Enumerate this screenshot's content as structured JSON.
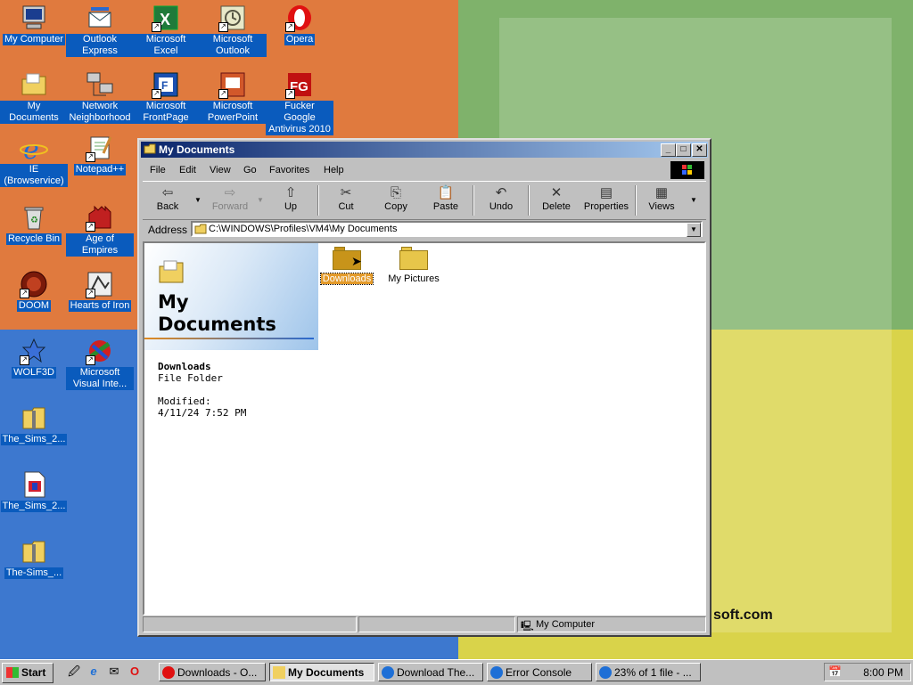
{
  "desktop": {
    "brand_text": "soft.com",
    "icons": [
      {
        "label": "My Computer",
        "icon": "computer-icon"
      },
      {
        "label": "Outlook Express",
        "icon": "outlook-express-icon"
      },
      {
        "label": "Microsoft Excel",
        "icon": "excel-icon"
      },
      {
        "label": "Microsoft Outlook",
        "icon": "outlook-icon"
      },
      {
        "label": "Opera",
        "icon": "opera-icon"
      },
      {
        "label": "My Documents",
        "icon": "folder-icon"
      },
      {
        "label": "Network Neighborhood",
        "icon": "network-icon"
      },
      {
        "label": "Microsoft FrontPage",
        "icon": "frontpage-icon"
      },
      {
        "label": "Microsoft PowerPoint",
        "icon": "powerpoint-icon"
      },
      {
        "label": "Fucker Google Antivirus 2010",
        "icon": "antivirus-icon"
      },
      {
        "label": "IE (Browservice)",
        "icon": "internet-explorer-icon"
      },
      {
        "label": "Notepad++",
        "icon": "notepad-icon"
      },
      {
        "label": "Recycle Bin",
        "icon": "recycle-bin-icon"
      },
      {
        "label": "Age of Empires",
        "icon": "age-of-empires-icon"
      },
      {
        "label": "DOOM",
        "icon": "doom-icon"
      },
      {
        "label": "Hearts of Iron",
        "icon": "hearts-of-iron-icon"
      },
      {
        "label": "WOLF3D",
        "icon": "wolf3d-icon"
      },
      {
        "label": "Microsoft Visual Inte...",
        "icon": "visual-interdev-icon"
      },
      {
        "label": "The_Sims_2...",
        "icon": "zip-icon"
      },
      {
        "label": "The_Sims_2...",
        "icon": "installer-icon"
      },
      {
        "label": "The-Sims_...",
        "icon": "zip-icon"
      }
    ]
  },
  "window": {
    "title": "My Documents",
    "menu": [
      "File",
      "Edit",
      "View",
      "Go",
      "Favorites",
      "Help"
    ],
    "toolbar": {
      "back": "Back",
      "forward": "Forward",
      "up": "Up",
      "cut": "Cut",
      "copy": "Copy",
      "paste": "Paste",
      "undo": "Undo",
      "delete": "Delete",
      "properties": "Properties",
      "views": "Views"
    },
    "address_label": "Address",
    "address_value": "C:\\WINDOWS\\Profiles\\VM4\\My Documents",
    "webview": {
      "title_line1": "My",
      "title_line2": "Documents",
      "selected_name": "Downloads",
      "selected_type": "File Folder",
      "modified_label": "Modified:",
      "modified_value": "4/11/24 7:52 PM"
    },
    "folders": [
      {
        "name": "Downloads",
        "selected": true
      },
      {
        "name": "My Pictures",
        "selected": false
      }
    ],
    "status": {
      "zone": "My Computer"
    }
  },
  "taskbar": {
    "start_label": "Start",
    "tasks": [
      {
        "label": "Downloads - O...",
        "icon": "opera-icon",
        "active": false
      },
      {
        "label": "My Documents",
        "icon": "folder-icon",
        "active": true
      },
      {
        "label": "Download The...",
        "icon": "internet-explorer-icon",
        "active": false
      },
      {
        "label": "Error Console",
        "icon": "internet-explorer-icon",
        "active": false
      },
      {
        "label": "23% of 1 file - ...",
        "icon": "internet-explorer-icon",
        "active": false
      }
    ],
    "clock": "8:00 PM"
  }
}
